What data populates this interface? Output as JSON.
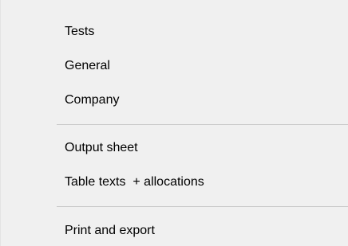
{
  "menu": {
    "items": [
      {
        "label": "Tests"
      },
      {
        "label": "General"
      },
      {
        "label": "Company"
      },
      {
        "label": "Output sheet"
      },
      {
        "label": "Table texts  + allocations"
      },
      {
        "label": "Print and export"
      }
    ]
  },
  "colors": {
    "background": "#f0f0f0",
    "separator": "#c8c8c8",
    "hover": "#cce4f7"
  }
}
